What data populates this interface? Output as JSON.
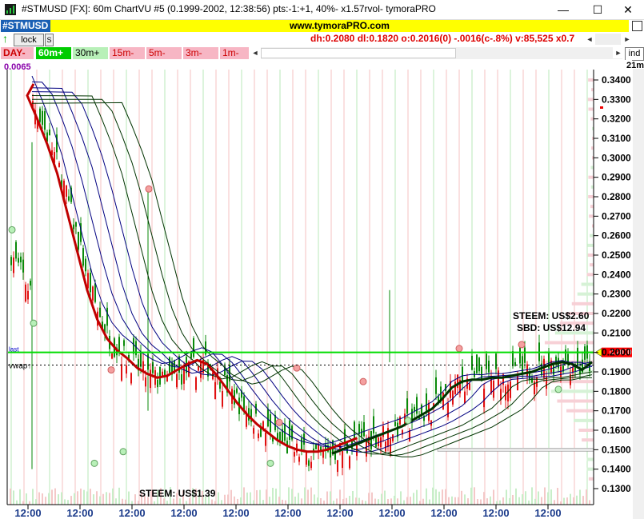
{
  "window": {
    "title": "#STMUSD [FX]: 60m ChartVU #5 (0.1999-2002, 12:38:56) pts:-1:+1, 40%- x1.57rvol- tymoraPRO",
    "minimize": "—",
    "maximize": "☐",
    "close": "✕"
  },
  "toolbar": {
    "symbol": "#STMUSD",
    "url": "www.tymoraPRO.com",
    "lock_label": "lock",
    "s_label": "S",
    "stats": "dh:0.2080  dl:0.1820  o:0.2016(0)  -.0016(c-.8%)  v:85,525 x0.7",
    "ind_label": "ind",
    "scroll_left": "◄",
    "scroll_right": "►"
  },
  "timeframes": [
    {
      "label": "DAY-",
      "style": "day"
    },
    {
      "label": "60m+",
      "style": "active"
    },
    {
      "label": "30m+",
      "style": "green"
    },
    {
      "label": "15m-",
      "style": "pink"
    },
    {
      "label": "5m-",
      "style": "pink"
    },
    {
      "label": "3m-",
      "style": "pink"
    },
    {
      "label": "1m-",
      "style": "pink"
    }
  ],
  "chart_data": {
    "type": "line",
    "corner_label": "21m",
    "left_value_label": "0.0065",
    "yaxis_ticks": [
      "0.3400",
      "0.3300",
      "0.3200",
      "0.3100",
      "0.3000",
      "0.2900",
      "0.2800",
      "0.2700",
      "0.2600",
      "0.2500",
      "0.2400",
      "0.2300",
      "0.2200",
      "0.2100",
      "0.2000",
      "0.1900",
      "0.1800",
      "0.1700",
      "0.1600",
      "0.1500",
      "0.1400",
      "0.1300"
    ],
    "ylim": [
      0.125,
      0.345
    ],
    "xaxis_ticks": [
      "12:00",
      "12:00",
      "12:00",
      "12:00",
      "12:00",
      "12:00",
      "12:00",
      "12:00",
      "12:00",
      "12:00",
      "12:00"
    ],
    "last_price": 0.2,
    "last_label": "last",
    "last_badge": "0.2000",
    "vwap_label": "vwap↑",
    "vwap_price": 0.1935,
    "annotations": [
      "STEEM: US$2.60",
      "SBD: US$12.94",
      "STEEM: US$1.39"
    ],
    "price_series": [
      0.33,
      0.318,
      0.305,
      0.29,
      0.27,
      0.25,
      0.23,
      0.215,
      0.205,
      0.199,
      0.195,
      0.19,
      0.187,
      0.185,
      0.186,
      0.189,
      0.192,
      0.194,
      0.192,
      0.186,
      0.179,
      0.172,
      0.166,
      0.161,
      0.157,
      0.153,
      0.15,
      0.148,
      0.147,
      0.147,
      0.148,
      0.15,
      0.152,
      0.154,
      0.156,
      0.158,
      0.16,
      0.162,
      0.165,
      0.168,
      0.171,
      0.176,
      0.182,
      0.185,
      0.186,
      0.186,
      0.187,
      0.187,
      0.188,
      0.189,
      0.19,
      0.192,
      0.194,
      0.195,
      0.194,
      0.191,
      0.195
    ],
    "series_colors": [
      "#003300",
      "#000080",
      "#c00000"
    ],
    "colors": {
      "up": "#0a8a0a",
      "down": "#e01010",
      "last_line": "#00dd00",
      "axis": "#000000"
    }
  }
}
